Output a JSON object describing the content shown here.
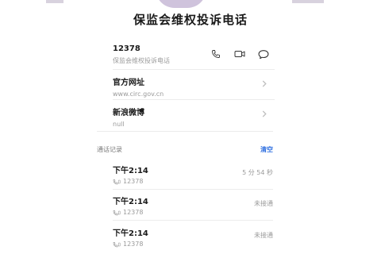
{
  "header": {
    "title": "保监会维权投诉电话"
  },
  "contact": {
    "number": "12378",
    "name": "保监会维权投诉电话"
  },
  "website": {
    "label": "官方网址",
    "value": "www.circ.gov.cn"
  },
  "weibo": {
    "label": "新浪微博",
    "value": "null"
  },
  "call_log": {
    "label": "通话记录",
    "clear": "清空",
    "records": [
      {
        "time": "下午2:14",
        "number": "12378",
        "status": "5 分 54 秒"
      },
      {
        "time": "下午2:14",
        "number": "12378",
        "status": "未接通"
      },
      {
        "time": "下午2:14",
        "number": "12378",
        "status": "未接通"
      }
    ]
  },
  "icons": {
    "call": "phone-icon",
    "video": "video-call-icon",
    "message": "message-icon",
    "chevron": "chevron-right-icon"
  },
  "colors": {
    "accent": "#2f6fe0",
    "muted": "#9a9a9a"
  }
}
